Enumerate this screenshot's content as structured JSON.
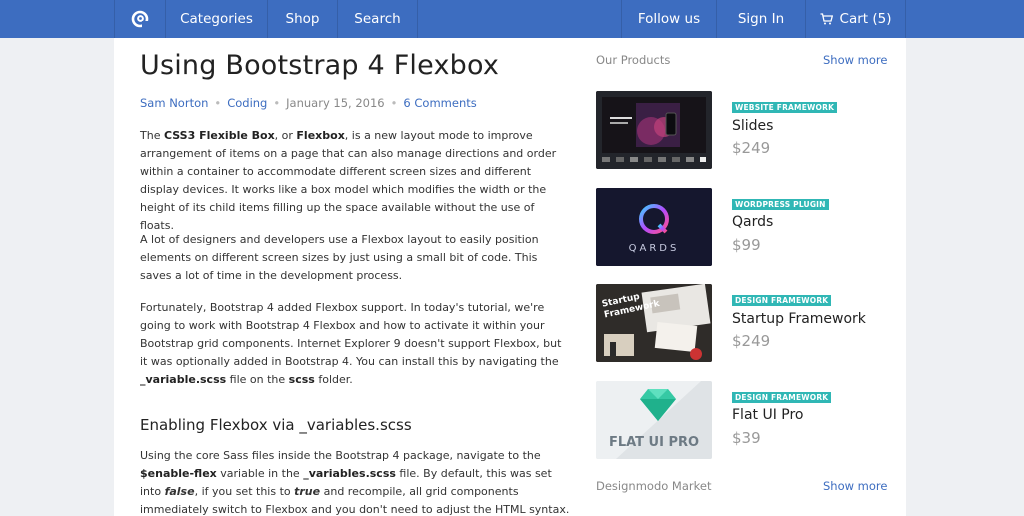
{
  "nav": {
    "logo_icon": "designmodo-logo-icon",
    "categories": "Categories",
    "shop": "Shop",
    "search": "Search",
    "follow": "Follow us",
    "signin": "Sign In",
    "cart": "Cart (5)",
    "cart_icon": "cart-icon"
  },
  "article": {
    "title": "Using Bootstrap 4 Flexbox",
    "author": "Sam Norton",
    "category": "Coding",
    "date": "January 15, 2016",
    "comments": "6 Comments",
    "p1": {
      "s1": "The ",
      "b1": "CSS3 Flexible Box",
      "s2": ", or ",
      "b2": "Flexbox",
      "s3": ", is a new layout mode to improve arrangement of items on a page that can also manage directions and order within a container to accommodate different screen sizes and different display devices. It works like a box model which modifies the width or the height of its child items filling up the space available without the use of floats."
    },
    "p2": "A lot of designers and developers use a Flexbox layout to easily position elements on different screen sizes by just using a small bit of code. This saves a lot of time in the development process.",
    "p3": {
      "s1": "Fortunately, Bootstrap 4 added Flexbox support. In today's tutorial, we're going to work with Bootstrap 4 Flexbox and how to activate it within your Bootstrap grid components. Internet Explorer 9 doesn't support Flexbox, but it was optionally added in Bootstrap 4. You can install this by navigating the ",
      "b1": "_variable.scss",
      "s2": " file on the ",
      "b2": "scss",
      "s3": " folder."
    },
    "h2": "Enabling Flexbox via _variables.scss",
    "p4": {
      "s1": "Using the core Sass files inside the Bootstrap 4 package, navigate to the ",
      "b1": "$enable-flex",
      "s2": " variable in the ",
      "b2": "_variables.scss",
      "s3": " file. By default, this was set into ",
      "i1": "false",
      "s4": ", if you set this to ",
      "i2": "true",
      "s5": " and recompile, all grid components immediately switch to Flexbox and you don't need to adjust the HTML syntax."
    }
  },
  "sidebar": {
    "products_heading": "Our Products",
    "show_more": "Show more",
    "market_heading": "Designmodo Market",
    "show_more_2": "Show more",
    "products": [
      {
        "badge": "WEBSITE FRAMEWORK",
        "name": "Slides",
        "price": "$249"
      },
      {
        "badge": "WORDPRESS PLUGIN",
        "name": "Qards",
        "price": "$99",
        "image_text": "QARDS"
      },
      {
        "badge": "DESIGN FRAMEWORK",
        "name": "Startup Framework",
        "price": "$249",
        "image_text": "Startup Framework"
      },
      {
        "badge": "DESIGN FRAMEWORK",
        "name": "Flat UI Pro",
        "price": "$39",
        "image_text": "FLAT UI PRO"
      }
    ]
  },
  "colors": {
    "nav": "#3d6dc0",
    "link": "#3d6dc0",
    "badge": "#30b7b5",
    "background": "#eef0f3"
  }
}
